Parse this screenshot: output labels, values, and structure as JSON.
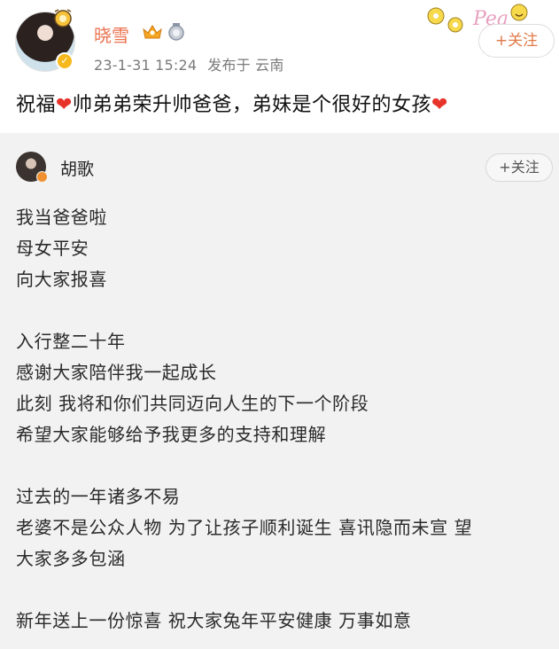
{
  "post": {
    "author": "晓雪",
    "date": "23-1-31 15:24",
    "source": "发布于 云南",
    "follow_label": "+关注",
    "sticker_text": "Pea",
    "text_part1": "祝福",
    "heart_glyph": "❤",
    "text_part2": "帅弟弟荣升帅爸爸，弟妹是个很好的女孩",
    "avatar_verify_glyph": "✓"
  },
  "repost": {
    "author": "胡歌",
    "follow_label": "+关注",
    "lines": [
      "我当爸爸啦",
      "母女平安",
      "向大家报喜",
      "",
      "入行整二十年",
      "感谢大家陪伴我一起成长",
      "此刻 我将和你们共同迈向人生的下一个阶段",
      "希望大家能够给予我更多的支持和理解",
      "",
      "过去的一年诸多不易",
      "老婆不是公众人物 为了让孩子顺利诞生 喜讯隐而未宣 望",
      "大家多多包涵",
      "",
      "新年送上一份惊喜 祝大家兔年平安健康 万事如意"
    ]
  },
  "colors": {
    "username": "#eb7350",
    "follow_accent": "#e07a48",
    "heart": "#e8332b",
    "repost_bg": "#f2f2f2",
    "verify_gold": "#f6b81c"
  },
  "icons": [
    "avatar-decoration-icon",
    "vip-crown-icon",
    "medal-icon",
    "verified-badge-icon",
    "sticker-icon",
    "heart-icon"
  ]
}
